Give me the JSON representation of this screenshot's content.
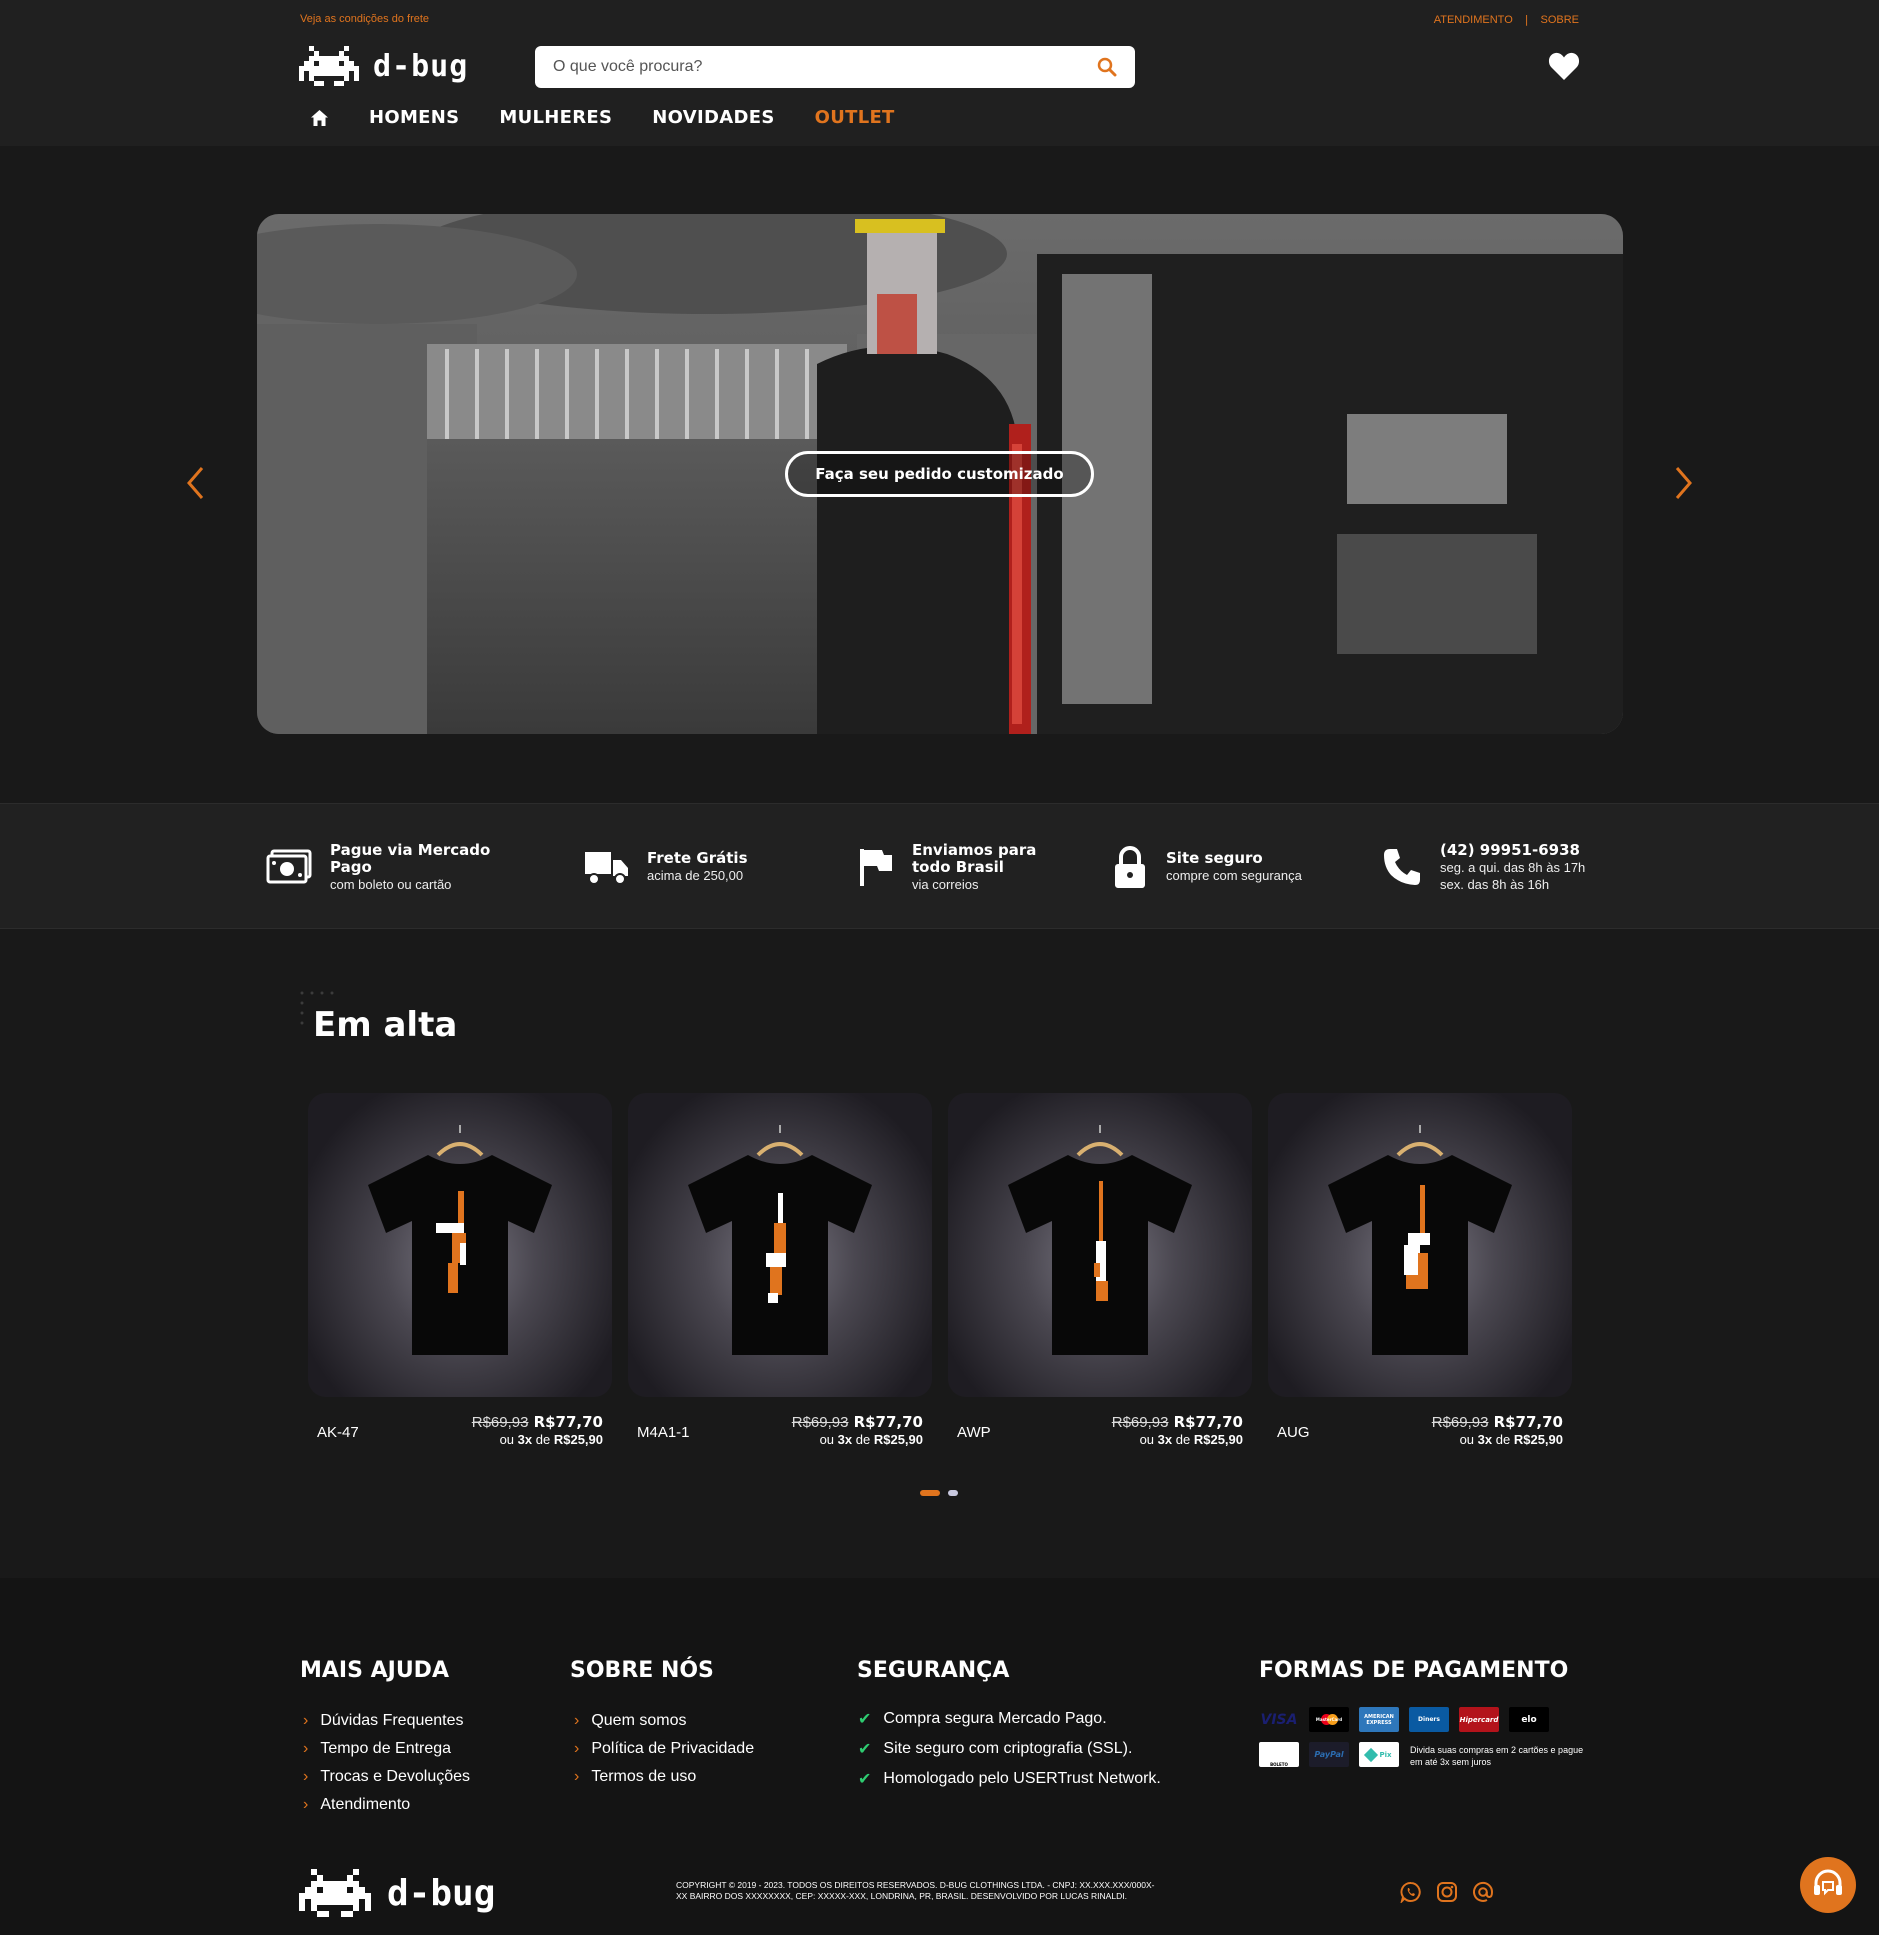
{
  "header": {
    "shipping_link": "Veja as condições do frete",
    "top_links": [
      "ATENDIMENTO",
      "SOBRE"
    ],
    "logo_text": "d-bug",
    "search_placeholder": "O que você procura?",
    "nav": [
      "HOMENS",
      "MULHERES",
      "NOVIDADES",
      "OUTLET"
    ]
  },
  "hero": {
    "cta": "Faça seu pedido customizado"
  },
  "features": [
    {
      "title": "Pague via Mercado Pago",
      "sub": "com boleto ou cartão",
      "icon": "money-icon"
    },
    {
      "title": "Frete Grátis",
      "sub": "acima de 250,00",
      "icon": "truck-icon"
    },
    {
      "title": "Enviamos para todo Brasil",
      "sub": "via correios",
      "icon": "flag-icon"
    },
    {
      "title": "Site seguro",
      "sub": "compre com segurança",
      "icon": "lock-icon"
    },
    {
      "title": "(42) 99951-6938",
      "sub": "seg. a qui. das 8h às 17h",
      "sub2": "sex. das 8h às 16h",
      "icon": "phone-icon"
    }
  ],
  "section": {
    "title": "Em alta"
  },
  "products": [
    {
      "name": "AK-47",
      "old_price": "R$69,93",
      "price": "R$77,70",
      "inst_prefix": "ou",
      "inst_count": "3x",
      "inst_mid": "de",
      "inst_value": "R$25,90"
    },
    {
      "name": "M4A1-1",
      "old_price": "R$69,93",
      "price": "R$77,70",
      "inst_prefix": "ou",
      "inst_count": "3x",
      "inst_mid": "de",
      "inst_value": "R$25,90"
    },
    {
      "name": "AWP",
      "old_price": "R$69,93",
      "price": "R$77,70",
      "inst_prefix": "ou",
      "inst_count": "3x",
      "inst_mid": "de",
      "inst_value": "R$25,90"
    },
    {
      "name": "AUG",
      "old_price": "R$69,93",
      "price": "R$77,70",
      "inst_prefix": "ou",
      "inst_count": "3x",
      "inst_mid": "de",
      "inst_value": "R$25,90"
    }
  ],
  "footer": {
    "help": {
      "title": "MAIS AJUDA",
      "items": [
        "Dúvidas Frequentes",
        "Tempo de Entrega",
        "Trocas e Devoluções",
        "Atendimento"
      ]
    },
    "about": {
      "title": "SOBRE NÓS",
      "items": [
        "Quem somos",
        "Política de Privacidade",
        "Termos de uso"
      ]
    },
    "security": {
      "title": "SEGURANÇA",
      "items": [
        "Compra segura Mercado Pago.",
        "Site seguro com criptografia (SSL).",
        "Homologado pelo USERTrust Network."
      ]
    },
    "payment": {
      "title": "FORMAS DE PAGAMENTO",
      "methods": [
        "VISA",
        "MasterCard",
        "AMERICAN EXPRESS",
        "Diners",
        "Hipercard",
        "elo",
        "BOLETO",
        "PayPal",
        "Pix"
      ],
      "note": "Divida suas compras em 2 cartões e pague em até 3x sem juros"
    },
    "logo_text": "d-bug",
    "copyright_line1": "COPYRIGHT © 2019 - 2023. TODOS OS DIREITOS RESERVADOS. D-BUG CLOTHINGS LTDA. - CNPJ: XX.XXX.XXX/000X-",
    "copyright_line2": "XX BAIRRO DOS XXXXXXXX, CEP: XXXXX-XXX, LONDRINA, PR, BRASIL. DESENVOLVIDO POR LUCAS RINALDI."
  },
  "colors": {
    "accent": "#e0741e",
    "background": "#191919",
    "header": "#202020",
    "footer": "#141414"
  }
}
